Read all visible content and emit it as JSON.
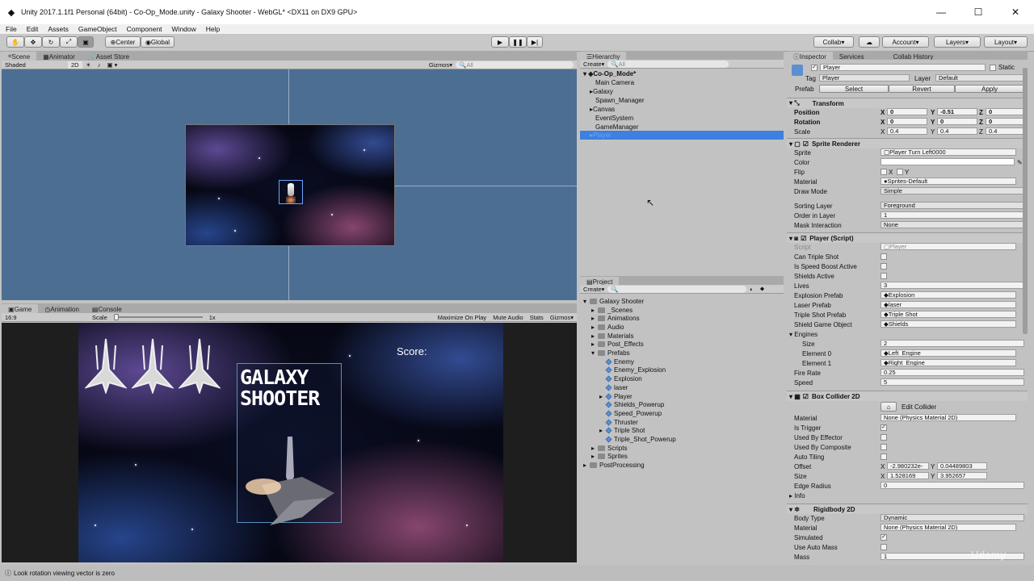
{
  "window": {
    "title": "Unity 2017.1.1f1 Personal (64bit) - Co-Op_Mode.unity - Galaxy Shooter - WebGL* <DX11 on DX9 GPU>"
  },
  "menu": [
    "File",
    "Edit",
    "Assets",
    "GameObject",
    "Component",
    "Window",
    "Help"
  ],
  "toolbar": {
    "center": "Center",
    "global": "Global",
    "collab": "Collab",
    "account": "Account",
    "layers": "Layers",
    "layout": "Layout"
  },
  "scene_tabs": {
    "scene": "Scene",
    "animator": "Animator",
    "asset_store": "Asset Store",
    "shaded": "Shaded",
    "twod": "2D",
    "gizmos": "Gizmos",
    "search": "All"
  },
  "game_tabs": {
    "game": "Game",
    "animation": "Animation",
    "console": "Console",
    "aspect": "16:9",
    "scale_label": "Scale",
    "scale_value": "1x",
    "maximize": "Maximize On Play",
    "mute": "Mute Audio",
    "stats": "Stats",
    "gizmos": "Gizmos"
  },
  "game_view": {
    "score": "Score:",
    "logo_line1": "GALAXY",
    "logo_line2": "SHOOTER"
  },
  "hierarchy": {
    "title": "Hierarchy",
    "create": "Create",
    "search": "All",
    "scene": "Co-Op_Mode*",
    "items": [
      "Main Camera",
      "Galaxy",
      "Spawn_Manager",
      "Canvas",
      "EventSystem",
      "GameManager",
      "Player"
    ]
  },
  "project": {
    "title": "Project",
    "create": "Create",
    "items": [
      {
        "label": "Galaxy Shooter",
        "kind": "folder"
      },
      {
        "label": "_Scenes",
        "kind": "folder"
      },
      {
        "label": "Animations",
        "kind": "folder"
      },
      {
        "label": "Audio",
        "kind": "folder"
      },
      {
        "label": "Materials",
        "kind": "folder"
      },
      {
        "label": "Post_Effects",
        "kind": "folder"
      },
      {
        "label": "Prefabs",
        "kind": "folder"
      },
      {
        "label": "Enemy",
        "kind": "prefab"
      },
      {
        "label": "Enemy_Explosion",
        "kind": "prefab"
      },
      {
        "label": "Explosion",
        "kind": "prefab"
      },
      {
        "label": "laser",
        "kind": "prefab"
      },
      {
        "label": "Player",
        "kind": "prefab"
      },
      {
        "label": "Shields_Powerup",
        "kind": "prefab"
      },
      {
        "label": "Speed_Powerup",
        "kind": "prefab"
      },
      {
        "label": "Thruster",
        "kind": "prefab"
      },
      {
        "label": "Triple Shot",
        "kind": "prefab"
      },
      {
        "label": "Triple_Shot_Powerup",
        "kind": "prefab"
      },
      {
        "label": "Scripts",
        "kind": "folder"
      },
      {
        "label": "Sprites",
        "kind": "folder"
      },
      {
        "label": "PostProcessing",
        "kind": "folder"
      }
    ]
  },
  "inspector": {
    "tabs": [
      "Inspector",
      "Services",
      "Collab History"
    ],
    "name": "Player",
    "static": "Static",
    "tag_label": "Tag",
    "tag": "Player",
    "layer_label": "Layer",
    "layer": "Default",
    "prefab_label": "Prefab",
    "select": "Select",
    "revert": "Revert",
    "apply": "Apply",
    "transform": {
      "title": "Transform",
      "position": "Position",
      "rotation": "Rotation",
      "scale": "Scale",
      "pos": [
        "0",
        "-0.51",
        "0"
      ],
      "rot": [
        "0",
        "0",
        "0"
      ],
      "scl": [
        "0.4",
        "0.4",
        "0.4"
      ]
    },
    "sprite_renderer": {
      "title": "Sprite Renderer",
      "sprite_label": "Sprite",
      "sprite": "Player Turn Left0000",
      "color_label": "Color",
      "flip_label": "Flip",
      "x": "X",
      "y": "Y",
      "material_label": "Material",
      "material": "Sprites-Default",
      "draw_mode_label": "Draw Mode",
      "draw_mode": "Simple",
      "sorting_layer_label": "Sorting Layer",
      "sorting_layer": "Foreground",
      "order_label": "Order in Layer",
      "order": "1",
      "mask_label": "Mask Interaction",
      "mask": "None"
    },
    "player_script": {
      "title": "Player (Script)",
      "script_label": "Script",
      "script": "Player",
      "triple": "Can Triple Shot",
      "speed_boost": "Is Speed Boost Active",
      "shields": "Shields Active",
      "lives_label": "Lives",
      "lives": "3",
      "explosion_label": "Explosion Prefab",
      "explosion": "Explosion",
      "laser_label": "Laser Prefab",
      "laser": "laser",
      "triple_label": "Triple Shot Prefab",
      "triple_prefab": "Triple Shot",
      "shield_go_label": "Shield Game Object",
      "shield_go": "Shields",
      "engines_label": "Engines",
      "size_label": "Size",
      "size": "2",
      "el0_label": "Element 0",
      "el0": "Left_Engine",
      "el1_label": "Element 1",
      "el1": "Right_Engine",
      "fire_label": "Fire Rate",
      "fire": "0.25",
      "speed_label": "Speed",
      "speed": "5"
    },
    "box_collider": {
      "title": "Box Collider 2D",
      "edit": "Edit Collider",
      "material_label": "Material",
      "material": "None (Physics Material 2D)",
      "trigger": "Is Trigger",
      "effector": "Used By Effector",
      "composite": "Used By Composite",
      "tiling": "Auto Tiling",
      "offset_label": "Offset",
      "offset_x": "-2.980232e-",
      "offset_y": "0.04489803",
      "size_label": "Size",
      "size_x": "1.528169",
      "size_y": "3.952657",
      "edge_label": "Edge Radius",
      "edge": "0",
      "info": "Info"
    },
    "rigidbody": {
      "title": "Rigidbody 2D",
      "body_label": "Body Type",
      "body": "Dynamic",
      "material_label": "Material",
      "material": "None (Physics Material 2D)",
      "simulated": "Simulated",
      "auto_mass": "Use Auto Mass",
      "mass_label": "Mass",
      "mass": "1"
    }
  },
  "status": "Look rotation viewing vector is zero",
  "watermark": "Udemy"
}
